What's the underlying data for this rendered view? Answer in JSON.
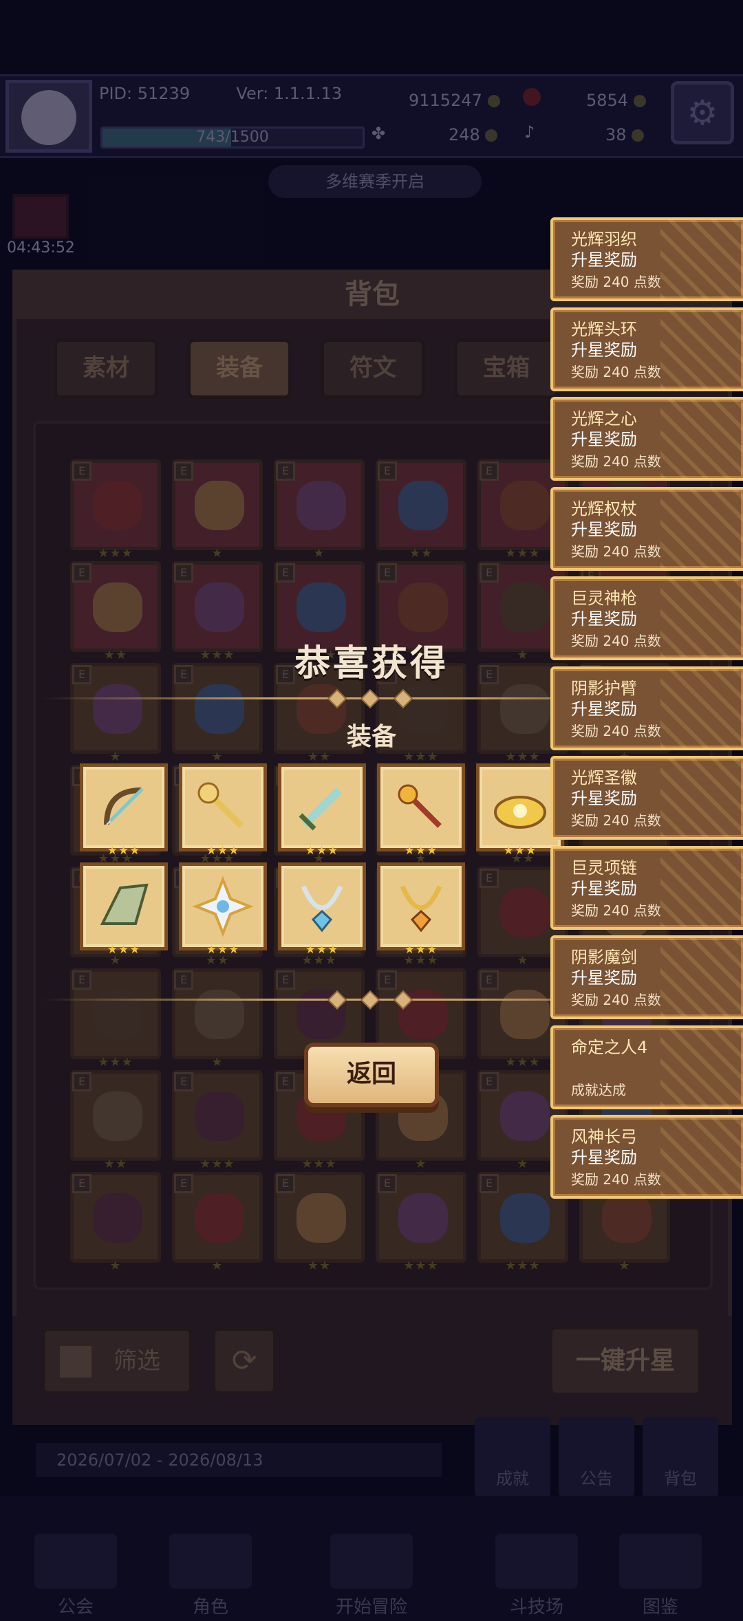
{
  "hud": {
    "pid_label": "PID: 51239",
    "version_label": "Ver: 1.1.1.13",
    "gold": "9115247",
    "gems": "5854",
    "exp_text": "743/1500",
    "exp_fraction": 0.495,
    "clover_count": "248",
    "key_count": "38",
    "timer": "04:43:52",
    "announcement": "多维赛季开启"
  },
  "bag": {
    "title": "背包",
    "tabs": [
      {
        "label": "素材",
        "active": false
      },
      {
        "label": "装备",
        "active": true
      },
      {
        "label": "符文",
        "active": false
      },
      {
        "label": "宝箱",
        "active": false
      }
    ],
    "filter_label": "筛选",
    "one_key_upstar_label": "一键升星",
    "date_range": "2026/07/02 - 2026/08/13",
    "slot_badge": "E"
  },
  "modal": {
    "title": "恭喜获得",
    "section": "装备",
    "back_label": "返回",
    "rewards": [
      {
        "name": "bow-icon",
        "stars": "★★★"
      },
      {
        "name": "golden-staff-icon",
        "stars": "★★★"
      },
      {
        "name": "sword-icon",
        "stars": "★★★"
      },
      {
        "name": "scepter-icon",
        "stars": "★★★"
      },
      {
        "name": "crown-icon",
        "stars": "★★★"
      },
      {
        "name": "wing-icon",
        "stars": "★★★"
      },
      {
        "name": "radiant-emblem-icon",
        "stars": "★★★"
      },
      {
        "name": "silver-necklace-icon",
        "stars": "★★★"
      },
      {
        "name": "gold-necklace-icon",
        "stars": "★★★"
      }
    ]
  },
  "notifications": [
    {
      "l1": "光辉羽织",
      "l2": "升星奖励",
      "l3": "奖励 240 点数"
    },
    {
      "l1": "光辉头环",
      "l2": "升星奖励",
      "l3": "奖励 240 点数"
    },
    {
      "l1": "光辉之心",
      "l2": "升星奖励",
      "l3": "奖励 240 点数"
    },
    {
      "l1": "光辉权杖",
      "l2": "升星奖励",
      "l3": "奖励 240 点数"
    },
    {
      "l1": "巨灵神枪",
      "l2": "升星奖励",
      "l3": "奖励 240 点数"
    },
    {
      "l1": "阴影护臂",
      "l2": "升星奖励",
      "l3": "奖励 240 点数"
    },
    {
      "l1": "光辉圣徽",
      "l2": "升星奖励",
      "l3": "奖励 240 点数"
    },
    {
      "l1": "巨灵项链",
      "l2": "升星奖励",
      "l3": "奖励 240 点数"
    },
    {
      "l1": "阴影魔剑",
      "l2": "升星奖励",
      "l3": "奖励 240 点数"
    },
    {
      "l1": "命定之人4",
      "l2": "",
      "l3": "成就达成"
    },
    {
      "l1": "风神长弓",
      "l2": "升星奖励",
      "l3": "奖励 240 点数"
    }
  ],
  "side_buttons": [
    "成就",
    "公告",
    "背包"
  ],
  "nav": [
    "公会",
    "角色",
    "开始冒险",
    "斗技场",
    "图鉴"
  ]
}
